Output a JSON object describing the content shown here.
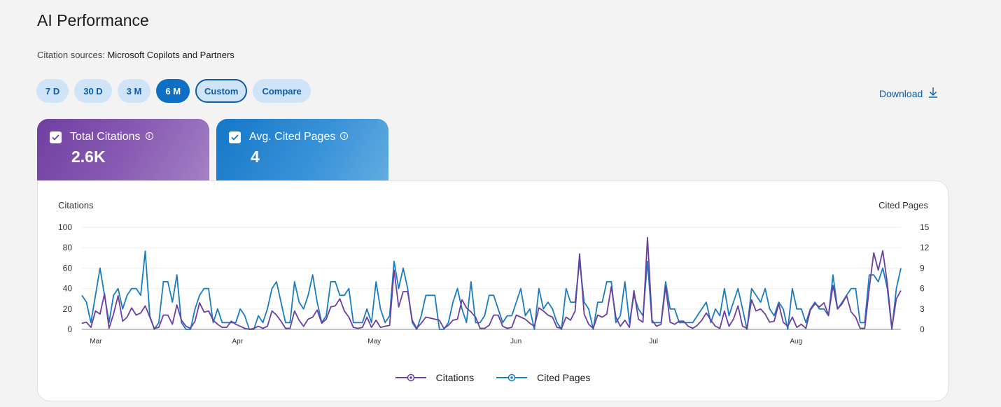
{
  "page": {
    "title": "AI Performance",
    "sources_label": "Citation sources:",
    "sources_value": "Microsoft Copilots and Partners",
    "download_label": "Download"
  },
  "ranges": [
    {
      "label": "7 D",
      "state": "default"
    },
    {
      "label": "30 D",
      "state": "default"
    },
    {
      "label": "3 M",
      "state": "default"
    },
    {
      "label": "6 M",
      "state": "active"
    },
    {
      "label": "Custom",
      "state": "outlined"
    },
    {
      "label": "Compare",
      "state": "default"
    }
  ],
  "cards": [
    {
      "label": "Total Citations",
      "value": "2.6K",
      "checked": true,
      "color": "#6f3fa0"
    },
    {
      "label": "Avg. Cited Pages",
      "value": "4",
      "checked": true,
      "color": "#1477c8"
    }
  ],
  "colors": {
    "citations": "#6b3fa0",
    "cited_pages": "#1a7bbf",
    "accent": "#0f6fc4"
  },
  "chart_data": {
    "type": "line",
    "left_axis_label": "Citations",
    "right_axis_label": "Cited Pages",
    "left_ticks": [
      0,
      20,
      40,
      60,
      80,
      100
    ],
    "right_ticks": [
      0,
      3,
      6,
      9,
      12,
      15
    ],
    "ylim_left": [
      0,
      100
    ],
    "ylim_right": [
      0,
      15
    ],
    "x_labels": [
      "Mar",
      "Apr",
      "May",
      "Jun",
      "Jul",
      "Aug"
    ],
    "legend_placement": "bottom-center",
    "series": [
      {
        "name": "Citations",
        "axis": "left",
        "values": [
          6,
          7,
          2,
          18,
          15,
          35,
          1,
          15,
          33,
          8,
          12,
          21,
          14,
          16,
          23,
          12,
          1,
          2,
          14,
          14,
          5,
          24,
          9,
          3,
          1,
          8,
          26,
          17,
          18,
          9,
          5,
          2,
          2,
          8,
          5,
          3,
          1,
          0,
          1,
          3,
          1,
          3,
          18,
          14,
          8,
          1,
          1,
          18,
          9,
          3,
          10,
          12,
          19,
          6,
          10,
          22,
          23,
          30,
          18,
          12,
          2,
          1,
          2,
          12,
          2,
          9,
          2,
          3,
          4,
          58,
          22,
          37,
          37,
          9,
          1,
          6,
          12,
          11,
          10,
          9,
          1,
          4,
          9,
          10,
          29,
          21,
          17,
          12,
          1,
          1,
          4,
          14,
          14,
          3,
          1,
          2,
          14,
          12,
          10,
          6,
          3,
          21,
          18,
          14,
          12,
          2,
          1,
          12,
          9,
          18,
          74,
          15,
          5,
          1,
          14,
          12,
          15,
          42,
          12,
          3,
          9,
          2,
          38,
          10,
          7,
          90,
          9,
          3,
          5,
          42,
          7,
          5,
          8,
          8,
          3,
          1,
          4,
          9,
          16,
          9,
          3,
          1,
          18,
          3,
          10,
          23,
          3,
          1,
          29,
          18,
          20,
          15,
          7,
          8,
          25,
          7,
          3,
          12,
          2,
          5,
          1,
          19,
          25,
          22,
          26,
          14,
          43,
          20,
          25,
          33,
          17,
          12,
          1,
          1,
          40,
          75,
          58,
          77,
          45,
          1,
          30,
          38
        ]
      },
      {
        "name": "Cited Pages",
        "axis": "right",
        "values": [
          5,
          4,
          1,
          5,
          9,
          5,
          1,
          5,
          6,
          3,
          5,
          6,
          6,
          5,
          11.5,
          2,
          0,
          1,
          7,
          7,
          4,
          8,
          1,
          0,
          0,
          3,
          5,
          6,
          6,
          1,
          3,
          1,
          1,
          1,
          1,
          3,
          2,
          0,
          0,
          2,
          1,
          3,
          6,
          7,
          4,
          1,
          1,
          7,
          4,
          3,
          5,
          8,
          4,
          1,
          2,
          7,
          7,
          5,
          5,
          6,
          1,
          1,
          1,
          3,
          1,
          7,
          3,
          1,
          2,
          10,
          6,
          9,
          6,
          1,
          0,
          2,
          5,
          5,
          5,
          0,
          0,
          1,
          4,
          6,
          3,
          1,
          7,
          1,
          1,
          2,
          5,
          5,
          3,
          1,
          2,
          2,
          4,
          6,
          2,
          3,
          0,
          6,
          3,
          4,
          3,
          1,
          0,
          6,
          4,
          4,
          10,
          4,
          3,
          0,
          4,
          4,
          7,
          7,
          1,
          2,
          7,
          1,
          5,
          3,
          2,
          10,
          1,
          1,
          1,
          7,
          3,
          3,
          1,
          1,
          1,
          1,
          2,
          3,
          4,
          1,
          3,
          2,
          6,
          2,
          4,
          6,
          3,
          0,
          6,
          5,
          4,
          6,
          3,
          2,
          4,
          3,
          0,
          6,
          3,
          3,
          1,
          3,
          4,
          3,
          3,
          2,
          8,
          3,
          4,
          5,
          6,
          6,
          1,
          1,
          8,
          8,
          7,
          9,
          6,
          0,
          6,
          9
        ]
      }
    ]
  }
}
